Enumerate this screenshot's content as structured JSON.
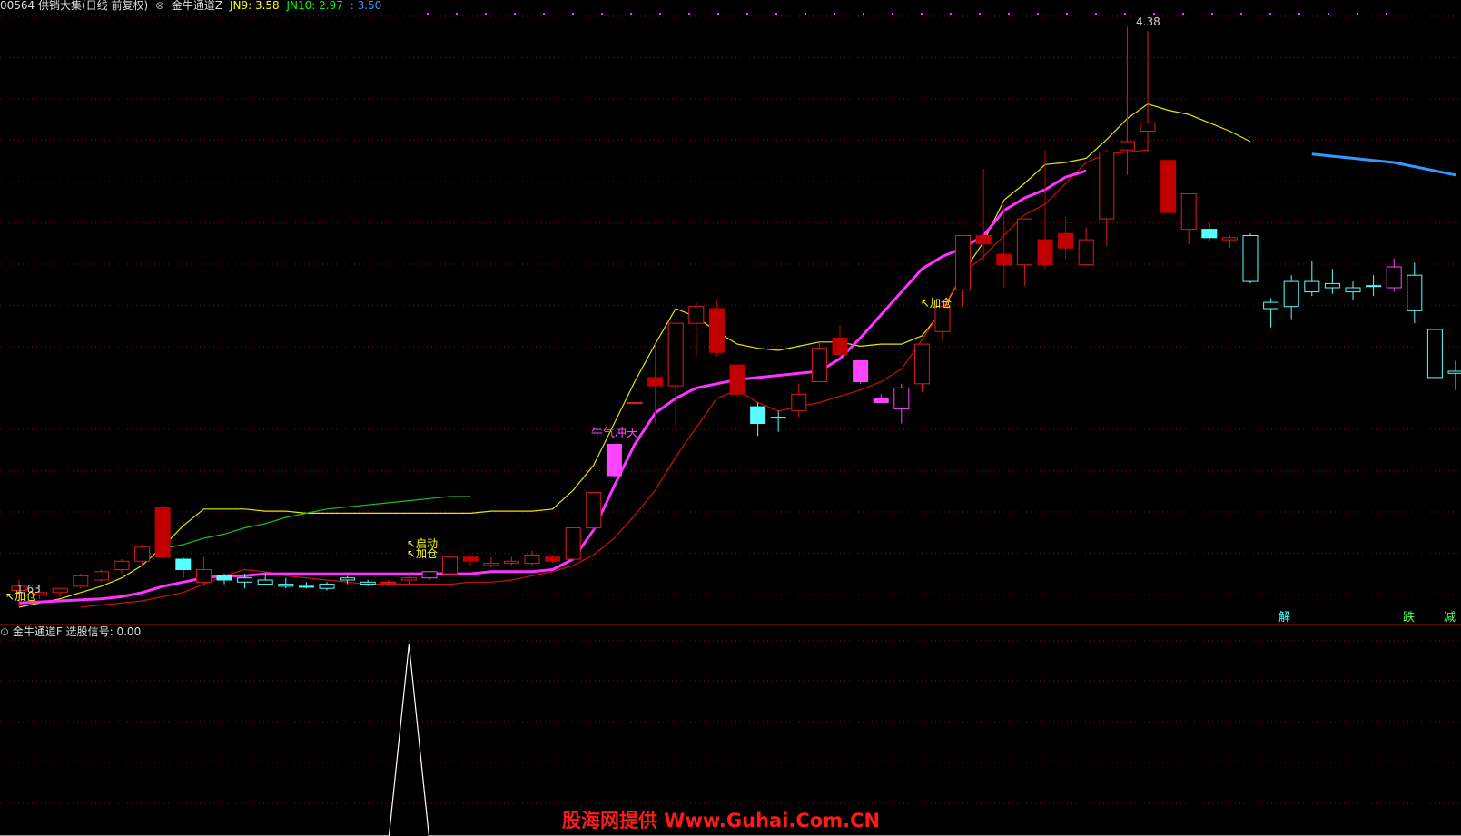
{
  "header": {
    "security": "00564 供销大集(日线 前复权)",
    "indicator": "金牛通道Z",
    "jn9_label": "JN9: 3.58",
    "jn10_label": "JN10: 2.97",
    "ma_label": ": 3.50",
    "colors": {
      "jn9": "#ffff00",
      "jn10": "#00ff00",
      "ma": "#3399ff"
    }
  },
  "sub_header": {
    "indicator": "金牛通道F",
    "signal_label": "选股信号: 0.00"
  },
  "annotations": {
    "high_price": "4.38",
    "low_price": "1.63",
    "add_position_1": "加仓",
    "add_position_2": "加仓",
    "add_position_3": "加仓",
    "launch": "启动",
    "bull_signal": "牛气冲天",
    "bottom_sig_1": "解",
    "bottom_sig_2": "跌",
    "bottom_sig_3": "减"
  },
  "watermark": "股海网提供 Www.Guhai.Com.CN",
  "chart_data": {
    "type": "candlestick",
    "y_range": [
      1.55,
      4.45
    ],
    "candles": [
      {
        "o": 1.72,
        "h": 1.75,
        "l": 1.62,
        "c": 1.7,
        "k": "red"
      },
      {
        "o": 1.69,
        "h": 1.73,
        "l": 1.66,
        "c": 1.68,
        "k": "red"
      },
      {
        "o": 1.69,
        "h": 1.71,
        "l": 1.67,
        "c": 1.71,
        "k": "red"
      },
      {
        "o": 1.72,
        "h": 1.78,
        "l": 1.71,
        "c": 1.77,
        "k": "red"
      },
      {
        "o": 1.75,
        "h": 1.8,
        "l": 1.74,
        "c": 1.79,
        "k": "red"
      },
      {
        "o": 1.8,
        "h": 1.85,
        "l": 1.78,
        "c": 1.84,
        "k": "red"
      },
      {
        "o": 1.84,
        "h": 1.92,
        "l": 1.82,
        "c": 1.91,
        "k": "red"
      },
      {
        "o": 2.1,
        "h": 2.12,
        "l": 1.85,
        "c": 1.86,
        "k": "redf"
      },
      {
        "o": 1.8,
        "h": 1.86,
        "l": 1.76,
        "c": 1.85,
        "k": "cyanf"
      },
      {
        "o": 1.74,
        "h": 1.86,
        "l": 1.73,
        "c": 1.8,
        "k": "red"
      },
      {
        "o": 1.75,
        "h": 1.78,
        "l": 1.73,
        "c": 1.77,
        "k": "cyanf"
      },
      {
        "o": 1.76,
        "h": 1.78,
        "l": 1.71,
        "c": 1.74,
        "k": "cyan"
      },
      {
        "o": 1.75,
        "h": 1.78,
        "l": 1.73,
        "c": 1.73,
        "k": "cyan"
      },
      {
        "o": 1.73,
        "h": 1.76,
        "l": 1.71,
        "c": 1.72,
        "k": "cyan"
      },
      {
        "o": 1.72,
        "h": 1.74,
        "l": 1.71,
        "c": 1.72,
        "k": "cyan"
      },
      {
        "o": 1.73,
        "h": 1.74,
        "l": 1.7,
        "c": 1.71,
        "k": "cyan"
      },
      {
        "o": 1.75,
        "h": 1.77,
        "l": 1.73,
        "c": 1.76,
        "k": "cyan"
      },
      {
        "o": 1.74,
        "h": 1.75,
        "l": 1.72,
        "c": 1.73,
        "k": "cyan"
      },
      {
        "o": 1.74,
        "h": 1.75,
        "l": 1.72,
        "c": 1.74,
        "k": "red"
      },
      {
        "o": 1.75,
        "h": 1.78,
        "l": 1.73,
        "c": 1.76,
        "k": "red"
      },
      {
        "o": 1.76,
        "h": 1.79,
        "l": 1.75,
        "c": 1.79,
        "k": "magenta"
      },
      {
        "o": 1.78,
        "h": 1.86,
        "l": 1.77,
        "c": 1.86,
        "k": "red"
      },
      {
        "o": 1.84,
        "h": 1.87,
        "l": 1.82,
        "c": 1.86,
        "k": "redf"
      },
      {
        "o": 1.82,
        "h": 1.86,
        "l": 1.81,
        "c": 1.83,
        "k": "red"
      },
      {
        "o": 1.83,
        "h": 1.86,
        "l": 1.82,
        "c": 1.84,
        "k": "red"
      },
      {
        "o": 1.83,
        "h": 1.89,
        "l": 1.82,
        "c": 1.87,
        "k": "red"
      },
      {
        "o": 1.86,
        "h": 1.87,
        "l": 1.83,
        "c": 1.84,
        "k": "redf"
      },
      {
        "o": 1.85,
        "h": 2.0,
        "l": 1.84,
        "c": 2.0,
        "k": "red"
      },
      {
        "o": 2.0,
        "h": 2.17,
        "l": 1.99,
        "c": 2.17,
        "k": "red"
      },
      {
        "o": 2.25,
        "h": 2.4,
        "l": 2.24,
        "c": 2.4,
        "k": "magentaf"
      },
      {
        "o": 2.6,
        "h": 2.6,
        "l": 2.6,
        "c": 2.6,
        "k": "red"
      },
      {
        "o": 2.72,
        "h": 2.88,
        "l": 2.5,
        "c": 2.68,
        "k": "redf"
      },
      {
        "o": 2.68,
        "h": 2.99,
        "l": 2.48,
        "c": 2.98,
        "k": "red"
      },
      {
        "o": 2.98,
        "h": 3.08,
        "l": 2.82,
        "c": 3.06,
        "k": "red"
      },
      {
        "o": 3.05,
        "h": 3.09,
        "l": 2.82,
        "c": 2.84,
        "k": "redf"
      },
      {
        "o": 2.78,
        "h": 2.78,
        "l": 2.63,
        "c": 2.64,
        "k": "redf"
      },
      {
        "o": 2.5,
        "h": 2.6,
        "l": 2.44,
        "c": 2.58,
        "k": "cyanf"
      },
      {
        "o": 2.53,
        "h": 2.56,
        "l": 2.46,
        "c": 2.53,
        "k": "cyan"
      },
      {
        "o": 2.56,
        "h": 2.69,
        "l": 2.53,
        "c": 2.64,
        "k": "red"
      },
      {
        "o": 2.86,
        "h": 2.89,
        "l": 2.7,
        "c": 2.7,
        "k": "red"
      },
      {
        "o": 2.91,
        "h": 2.97,
        "l": 2.83,
        "c": 2.83,
        "k": "redf"
      },
      {
        "o": 2.8,
        "h": 2.8,
        "l": 2.69,
        "c": 2.7,
        "k": "magentaf"
      },
      {
        "o": 2.62,
        "h": 2.64,
        "l": 2.6,
        "c": 2.6,
        "k": "magentaf"
      },
      {
        "o": 2.57,
        "h": 2.69,
        "l": 2.5,
        "c": 2.67,
        "k": "magenta"
      },
      {
        "o": 2.69,
        "h": 2.88,
        "l": 2.65,
        "c": 2.88,
        "k": "red"
      },
      {
        "o": 2.94,
        "h": 3.06,
        "l": 2.9,
        "c": 3.06,
        "k": "red"
      },
      {
        "o": 3.14,
        "h": 3.4,
        "l": 3.06,
        "c": 3.4,
        "k": "red"
      },
      {
        "o": 3.4,
        "h": 3.72,
        "l": 3.28,
        "c": 3.36,
        "k": "redf"
      },
      {
        "o": 3.31,
        "h": 3.55,
        "l": 3.15,
        "c": 3.26,
        "k": "redf"
      },
      {
        "o": 3.26,
        "h": 3.48,
        "l": 3.16,
        "c": 3.48,
        "k": "red"
      },
      {
        "o": 3.38,
        "h": 3.81,
        "l": 3.24,
        "c": 3.26,
        "k": "redf"
      },
      {
        "o": 3.41,
        "h": 3.49,
        "l": 3.29,
        "c": 3.34,
        "k": "redf"
      },
      {
        "o": 3.38,
        "h": 3.44,
        "l": 3.26,
        "c": 3.26,
        "k": "red"
      },
      {
        "o": 3.48,
        "h": 3.81,
        "l": 3.35,
        "c": 3.8,
        "k": "red"
      },
      {
        "o": 3.81,
        "h": 4.4,
        "l": 3.69,
        "c": 3.85,
        "k": "red"
      },
      {
        "o": 3.9,
        "h": 4.38,
        "l": 3.8,
        "c": 3.94,
        "k": "red"
      },
      {
        "o": 3.76,
        "h": 3.76,
        "l": 3.51,
        "c": 3.51,
        "k": "redf"
      },
      {
        "o": 3.43,
        "h": 3.59,
        "l": 3.36,
        "c": 3.6,
        "k": "red"
      },
      {
        "o": 3.43,
        "h": 3.46,
        "l": 3.37,
        "c": 3.39,
        "k": "cyanf"
      },
      {
        "o": 3.39,
        "h": 3.4,
        "l": 3.34,
        "c": 3.38,
        "k": "red"
      },
      {
        "o": 3.4,
        "h": 3.41,
        "l": 3.17,
        "c": 3.18,
        "k": "cyan"
      },
      {
        "o": 3.05,
        "h": 3.1,
        "l": 2.96,
        "c": 3.08,
        "k": "cyan"
      },
      {
        "o": 3.06,
        "h": 3.21,
        "l": 3.0,
        "c": 3.18,
        "k": "cyan"
      },
      {
        "o": 3.13,
        "h": 3.28,
        "l": 3.11,
        "c": 3.18,
        "k": "cyan"
      },
      {
        "o": 3.17,
        "h": 3.24,
        "l": 3.12,
        "c": 3.15,
        "k": "cyan"
      },
      {
        "o": 3.13,
        "h": 3.18,
        "l": 3.09,
        "c": 3.15,
        "k": "cyan"
      },
      {
        "o": 3.16,
        "h": 3.21,
        "l": 3.11,
        "c": 3.16,
        "k": "cyan"
      },
      {
        "o": 3.15,
        "h": 3.29,
        "l": 3.13,
        "c": 3.25,
        "k": "magenta"
      },
      {
        "o": 3.21,
        "h": 3.27,
        "l": 2.98,
        "c": 3.04,
        "k": "cyan"
      },
      {
        "o": 2.95,
        "h": 2.95,
        "l": 2.72,
        "c": 2.72,
        "k": "cyan"
      },
      {
        "o": 2.74,
        "h": 2.8,
        "l": 2.66,
        "c": 2.75,
        "k": "cyan"
      }
    ],
    "lines": {
      "yellow": [
        1.62,
        1.64,
        1.66,
        1.69,
        1.72,
        1.76,
        1.82,
        1.91,
        2.01,
        2.09,
        2.09,
        2.09,
        2.08,
        2.08,
        2.07,
        2.07,
        2.07,
        2.07,
        2.07,
        2.07,
        2.07,
        2.07,
        2.07,
        2.08,
        2.08,
        2.08,
        2.09,
        2.18,
        2.3,
        2.5,
        2.7,
        2.88,
        3.05,
        3.01,
        2.94,
        2.88,
        2.86,
        2.85,
        2.87,
        2.89,
        2.89,
        2.87,
        2.88,
        2.88,
        2.92,
        3.04,
        3.22,
        3.37,
        3.57,
        3.65,
        3.74,
        3.75,
        3.77,
        3.86,
        3.96,
        4.03,
        4.0,
        3.98,
        3.94,
        3.9,
        3.85
      ],
      "red": [
        1.62,
        1.63,
        1.64,
        1.65,
        1.67,
        1.69,
        1.73,
        1.77,
        1.8,
        1.79,
        1.77,
        1.76,
        1.75,
        1.74,
        1.73,
        1.73,
        1.73,
        1.73,
        1.73,
        1.74,
        1.74,
        1.75,
        1.77,
        1.79,
        1.82,
        1.87,
        1.95,
        2.06,
        2.18,
        2.34,
        2.48,
        2.62,
        2.66,
        2.6,
        2.56,
        2.58,
        2.6,
        2.63,
        2.66,
        2.7,
        2.76,
        2.9,
        3.05,
        3.22,
        3.3,
        3.4,
        3.5,
        3.55,
        3.65,
        3.75,
        3.79,
        3.8,
        3.81
      ],
      "magenta": [
        1.64,
        1.645,
        1.65,
        1.655,
        1.66,
        1.67,
        1.69,
        1.72,
        1.74,
        1.76,
        1.77,
        1.77,
        1.78,
        1.78,
        1.78,
        1.78,
        1.78,
        1.78,
        1.78,
        1.78,
        1.78,
        1.78,
        1.78,
        1.79,
        1.79,
        1.79,
        1.8,
        1.85,
        1.99,
        2.2,
        2.4,
        2.55,
        2.62,
        2.67,
        2.69,
        2.71,
        2.72,
        2.73,
        2.74,
        2.75,
        2.81,
        2.91,
        3.02,
        3.13,
        3.24,
        3.3,
        3.34,
        3.4,
        3.52,
        3.58,
        3.62,
        3.68,
        3.71
      ],
      "blue": [
        3.79,
        3.78,
        3.77,
        3.76,
        3.75,
        3.73,
        3.71,
        3.69
      ],
      "green": [
        1.9,
        1.92,
        1.95,
        1.97,
        2.0,
        2.02,
        2.05,
        2.07,
        2.09,
        2.1,
        2.11,
        2.12,
        2.13,
        2.14,
        2.15,
        2.15
      ]
    },
    "sub_chart": {
      "type": "line",
      "signal_index": 19,
      "value": 0.0,
      "peak": 1
    }
  }
}
